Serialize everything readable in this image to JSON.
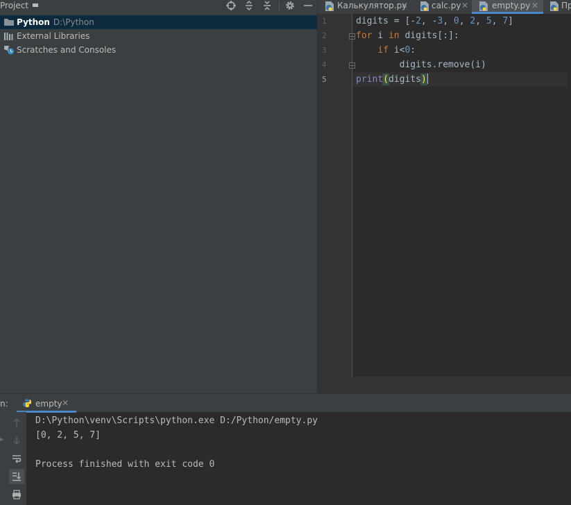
{
  "project_panel": {
    "title": "Project",
    "tree": [
      {
        "label": "Python",
        "path": "D:\\Python",
        "selected": true,
        "icon": "folder-icon"
      },
      {
        "label": "External Libraries",
        "icon": "libraries-icon"
      },
      {
        "label": "Scratches and Consoles",
        "icon": "scratches-icon"
      }
    ]
  },
  "editor": {
    "tabs": [
      {
        "label": "Калькулятор.py",
        "active": false
      },
      {
        "label": "calc.py",
        "active": false
      },
      {
        "label": "empty.py",
        "active": true
      },
      {
        "label": "Пр",
        "active": false
      }
    ],
    "line_numbers": [
      "1",
      "2",
      "3",
      "4",
      "5"
    ],
    "code_lines": [
      "digits = [-2, -3, 0, 2, 5, 7]",
      "for i in digits[:]:",
      "    if i<0:",
      "        digits.remove(i)",
      "print(digits)"
    ],
    "current_line": 5
  },
  "run_panel": {
    "label": "n:",
    "tab_label": "empty",
    "console_lines": [
      "D:\\Python\\venv\\Scripts\\python.exe D:/Python/empty.py",
      "[0, 2, 5, 7]",
      "",
      "Process finished with exit code 0"
    ]
  },
  "colors": {
    "accent": "#4a88c7",
    "selection": "#0d293e",
    "keyword": "#cc7832",
    "number": "#6897bb",
    "builtin": "#8888c6",
    "paren_match": "#ffef28"
  }
}
